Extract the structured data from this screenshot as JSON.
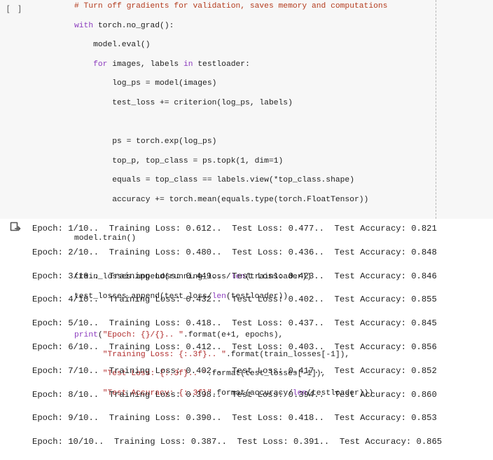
{
  "cell": {
    "execution_count": "[ ]",
    "code_lines": [
      "# Turn off gradients for validation, saves memory and computations",
      "with torch.no_grad():",
      "    model.eval()",
      "    for images, labels in testloader:",
      "        log_ps = model(images)",
      "        test_loss += criterion(log_ps, labels)",
      "",
      "        ps = torch.exp(log_ps)",
      "        top_p, top_class = ps.topk(1, dim=1)",
      "        equals = top_class == labels.view(*top_class.shape)",
      "        accuracy += torch.mean(equals.type(torch.FloatTensor))",
      "",
      "model.train()",
      "",
      "train_losses.append(running_loss/len(trainloader))",
      "test_losses.append(test_loss/len(testloader))",
      "",
      "print(\"Epoch: {}/{}.. \".format(e+1, epochs),",
      "      \"Training Loss: {:.3f}.. \".format(train_losses[-1]),",
      "      \"Test Loss: {:.3f}.. \".format(test_losses[-1]),",
      "      \"Test Accuracy: {:.3f}\".format(accuracy/len(testloader)))"
    ]
  },
  "output": {
    "icon": "output-arrow-icon",
    "lines": [
      "Epoch: 1/10..  Training Loss: 0.612..  Test Loss: 0.477..  Test Accuracy: 0.821",
      "Epoch: 2/10..  Training Loss: 0.480..  Test Loss: 0.436..  Test Accuracy: 0.848",
      "Epoch: 3/10..  Training Loss: 0.449..  Test Loss: 0.423..  Test Accuracy: 0.846",
      "Epoch: 4/10..  Training Loss: 0.432..  Test Loss: 0.402..  Test Accuracy: 0.855",
      "Epoch: 5/10..  Training Loss: 0.418..  Test Loss: 0.437..  Test Accuracy: 0.845",
      "Epoch: 6/10..  Training Loss: 0.412..  Test Loss: 0.403..  Test Accuracy: 0.856",
      "Epoch: 7/10..  Training Loss: 0.402..  Test Loss: 0.417..  Test Accuracy: 0.852",
      "Epoch: 8/10..  Training Loss: 0.398..  Test Loss: 0.394..  Test Accuracy: 0.860",
      "Epoch: 9/10..  Training Loss: 0.390..  Test Loss: 0.418..  Test Accuracy: 0.853",
      "Epoch: 10/10..  Training Loss: 0.387..  Test Loss: 0.391..  Test Accuracy: 0.865"
    ]
  }
}
